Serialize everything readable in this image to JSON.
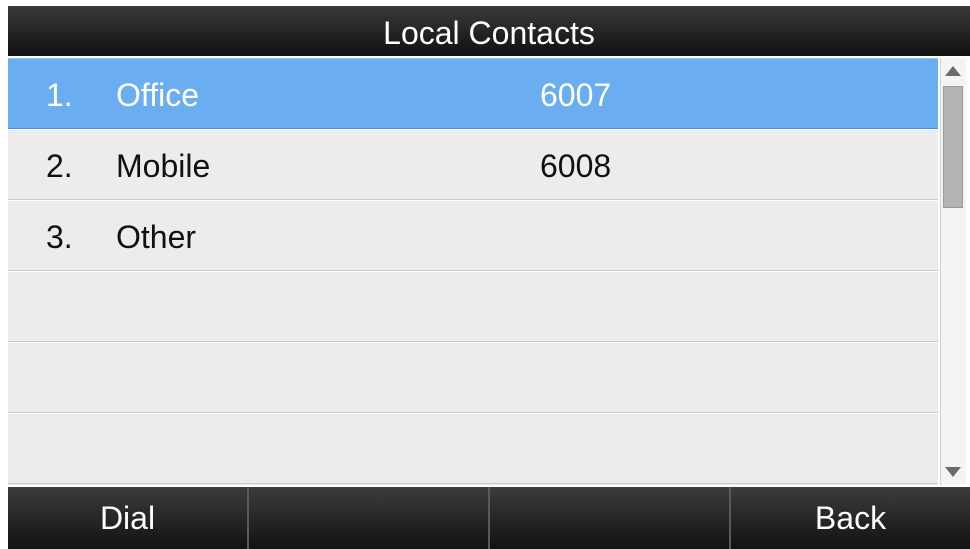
{
  "title": "Local Contacts",
  "contacts": [
    {
      "index": "1.",
      "name": "Office",
      "number": "6007",
      "selected": true
    },
    {
      "index": "2.",
      "name": "Mobile",
      "number": "6008",
      "selected": false
    },
    {
      "index": "3.",
      "name": "Other",
      "number": "",
      "selected": false
    },
    {
      "index": "",
      "name": "",
      "number": "",
      "selected": false
    },
    {
      "index": "",
      "name": "",
      "number": "",
      "selected": false
    },
    {
      "index": "",
      "name": "",
      "number": "",
      "selected": false
    }
  ],
  "softkeys": [
    "Dial",
    "",
    "",
    "Back"
  ],
  "colors": {
    "selected_row": "#6aadf1",
    "row_background": "#ececec",
    "bar_background": "#1a1a1a"
  },
  "icons": {
    "scroll_up": "triangle-up-icon",
    "scroll_down": "triangle-down-icon"
  }
}
